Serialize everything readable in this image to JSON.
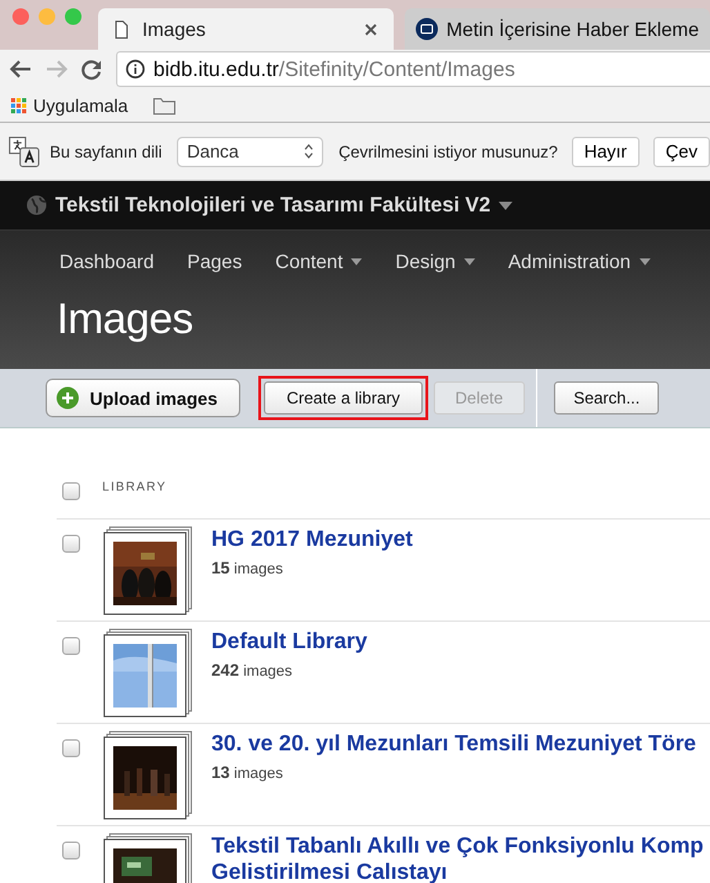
{
  "browser": {
    "tabs": [
      {
        "title": "Images",
        "selected": true
      },
      {
        "title": "Metin İçerisine Haber Ekleme",
        "selected": false
      }
    ],
    "url": {
      "host": "bidb.itu.edu.tr",
      "path": "/Sitefinity/Content/Images"
    },
    "bookmarks": [
      {
        "label": "Uygulamala",
        "kind": "apps"
      },
      {
        "kind": "folder"
      }
    ]
  },
  "translate_bar": {
    "label": "Bu sayfanın dili",
    "language": "Danca",
    "question": "Çevrilmesini istiyor musunuz?",
    "buttons": [
      "Hayır",
      "Çev"
    ]
  },
  "site": {
    "title": "Tekstil Teknolojileri ve Tasarımı Fakültesi V2",
    "nav": [
      {
        "label": "Dashboard",
        "dropdown": false
      },
      {
        "label": "Pages",
        "dropdown": false
      },
      {
        "label": "Content",
        "dropdown": true
      },
      {
        "label": "Design",
        "dropdown": true
      },
      {
        "label": "Administration",
        "dropdown": true
      }
    ]
  },
  "page_title": "Images",
  "toolbar": [
    {
      "label": "Upload images",
      "kind": "primary",
      "disabled": false,
      "highlighted": false
    },
    {
      "label": "Create a library",
      "kind": "normal",
      "disabled": false,
      "highlighted": true
    },
    {
      "label": "Delete",
      "kind": "normal",
      "disabled": true,
      "highlighted": false
    },
    {
      "label": "Search...",
      "kind": "search",
      "disabled": false,
      "highlighted": false
    }
  ],
  "table": {
    "column": "LIBRARY",
    "all_checked": false,
    "rows": [
      {
        "title": "HG 2017 Mezuniyet",
        "count": "15",
        "unit": "images",
        "checked": false
      },
      {
        "title": "Default Library",
        "count": "242",
        "unit": "images",
        "checked": false
      },
      {
        "title": "30. ve 20. yıl Mezunları Temsili Mezuniyet Töre",
        "count": "13",
        "unit": "images",
        "checked": false
      },
      {
        "title": "Tekstil Tabanlı Akıllı ve Çok Fonksiyonlu Komp",
        "title_line2": "Gelistirilmesi Calıstayı",
        "checked": false
      }
    ]
  }
}
